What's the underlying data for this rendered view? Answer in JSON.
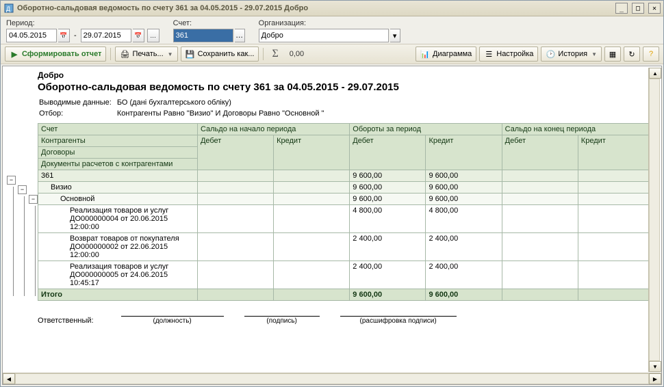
{
  "window": {
    "title": "Оборотно-сальдовая ведомость по счету 361 за 04.05.2015 - 29.07.2015 Добро"
  },
  "params": {
    "period_label": "Период:",
    "date_from": "04.05.2015",
    "date_to": "29.07.2015",
    "dash": "-",
    "account_label": "Счет:",
    "account": "361",
    "org_label": "Организация:",
    "org": "Добро"
  },
  "toolbar": {
    "form": "Сформировать отчет",
    "print": "Печать...",
    "save": "Сохранить как...",
    "sigma": "Σ",
    "sigma_val": "0,00",
    "diagram": "Диаграмма",
    "settings": "Настройка",
    "history": "История"
  },
  "doc": {
    "org": "Добро",
    "title": "Оборотно-сальдовая ведомость по счету 361 за 04.05.2015 - 29.07.2015",
    "out_label": "Выводимые данные:",
    "out_value": "БО (дані бухгалтерського обліку)",
    "filter_label": "Отбор:",
    "filter_value": "Контрагенты Равно \"Визио\" И Договоры Равно \"Основной \""
  },
  "headers": {
    "account": "Счет",
    "start": "Сальдо на начало периода",
    "turn": "Обороты за период",
    "end": "Сальдо на конец периода",
    "contr": "Контрагенты",
    "debit": "Дебет",
    "credit": "Кредит",
    "contracts": "Договоры",
    "docs": "Документы расчетов с контрагентами"
  },
  "rows": [
    {
      "lvl": 0,
      "name": "361",
      "sd": "",
      "sc": "",
      "td": "9 600,00",
      "tc": "9 600,00",
      "ed": "",
      "ec": ""
    },
    {
      "lvl": 1,
      "name": "Визио",
      "sd": "",
      "sc": "",
      "td": "9 600,00",
      "tc": "9 600,00",
      "ed": "",
      "ec": ""
    },
    {
      "lvl": 2,
      "name": "Основной",
      "sd": "",
      "sc": "",
      "td": "9 600,00",
      "tc": "9 600,00",
      "ed": "",
      "ec": ""
    },
    {
      "lvl": 3,
      "name": "Реализация товаров и услуг ДО000000004 от 20.06.2015 12:00:00",
      "sd": "",
      "sc": "",
      "td": "4 800,00",
      "tc": "4 800,00",
      "ed": "",
      "ec": ""
    },
    {
      "lvl": 3,
      "name": "Возврат товаров от покупателя ДО000000002 от 22.06.2015 12:00:00",
      "sd": "",
      "sc": "",
      "td": "2 400,00",
      "tc": "2 400,00",
      "ed": "",
      "ec": ""
    },
    {
      "lvl": 3,
      "name": "Реализация товаров и услуг ДО000000005 от 24.06.2015 10:45:17",
      "sd": "",
      "sc": "",
      "td": "2 400,00",
      "tc": "2 400,00",
      "ed": "",
      "ec": ""
    }
  ],
  "total": {
    "name": "Итого",
    "td": "9 600,00",
    "tc": "9 600,00"
  },
  "sign": {
    "resp": "Ответственный:",
    "post": "(должность)",
    "sig": "(подпись)",
    "full": "(расшифровка подписи)"
  }
}
